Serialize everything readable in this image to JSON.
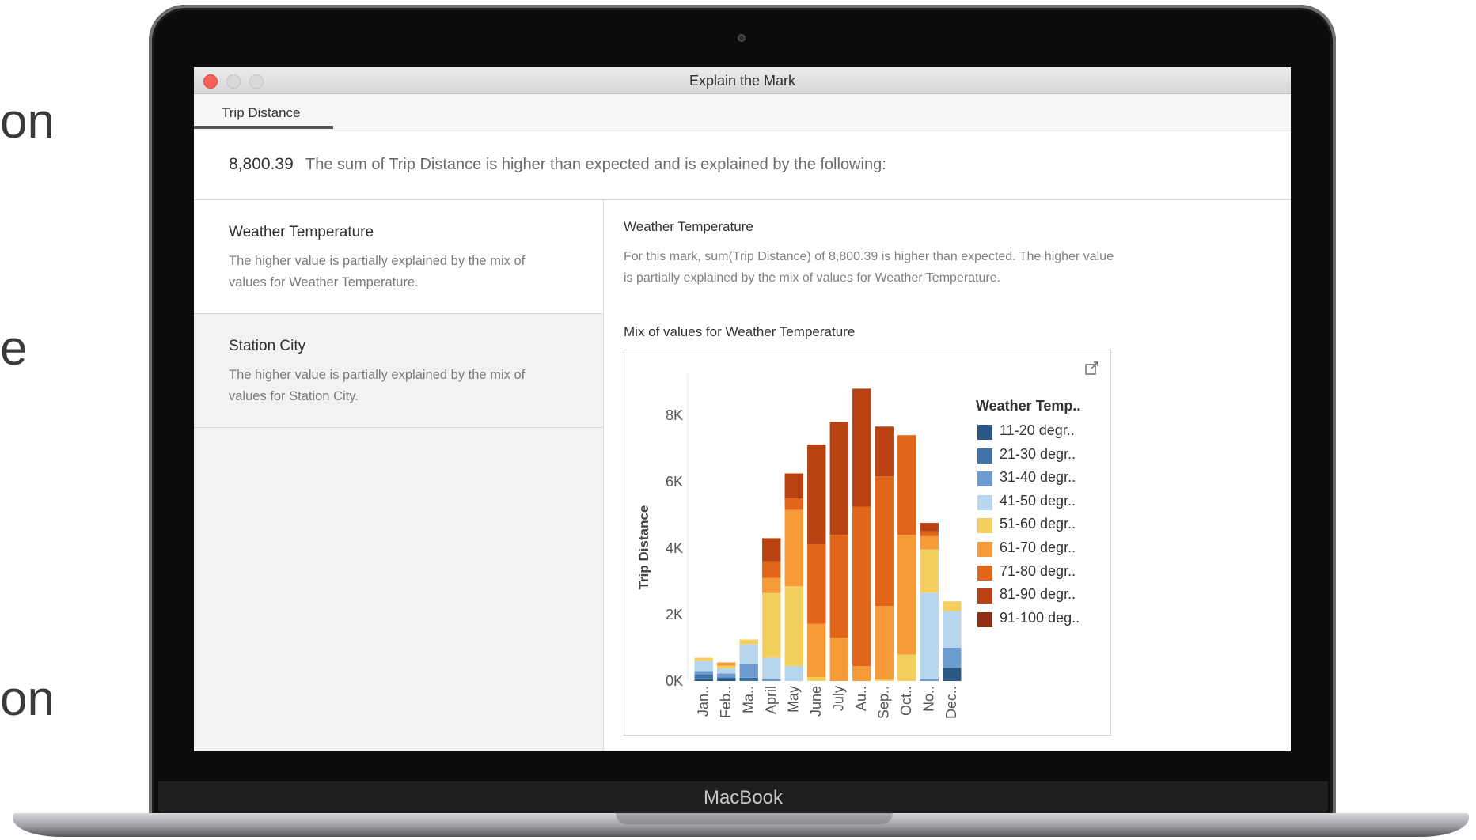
{
  "background_words": [
    "on",
    "e",
    "on"
  ],
  "device": {
    "brand": "MacBook"
  },
  "window": {
    "title": "Explain the Mark"
  },
  "tab": {
    "label": "Trip Distance"
  },
  "summary": {
    "value": "8,800.39",
    "text": "The sum of Trip Distance is higher than expected and is explained by the following:"
  },
  "explanations": [
    {
      "title": "Weather Temperature",
      "description": "The higher value is partially explained by the mix of values for Weather Temperature."
    },
    {
      "title": "Station City",
      "description": "The higher value is partially explained by the mix of values for Station City."
    }
  ],
  "detail": {
    "title": "Weather Temperature",
    "description": "For this mark, sum(Trip Distance) of 8,800.39 is higher than expected. The higher value is partially explained by the mix of values for Weather Temperature.",
    "chart_heading": "Mix of values for Weather Temperature"
  },
  "chart_data": {
    "type": "bar",
    "stacked": true,
    "ylabel": "Trip Distance",
    "yticks": [
      "0K",
      "2K",
      "4K",
      "6K",
      "8K"
    ],
    "ylim": [
      0,
      9000
    ],
    "categories": [
      "Jan..",
      "Feb..",
      "Ma..",
      "April",
      "May",
      "June",
      "July",
      "Au..",
      "Sep..",
      "Oct..",
      "No..",
      "Dec.."
    ],
    "legend_title": "Weather Temp..",
    "series": [
      {
        "name": "11-20 degr..",
        "color": "#2a5783",
        "values": [
          80,
          50,
          0,
          0,
          0,
          0,
          0,
          0,
          0,
          0,
          0,
          400
        ]
      },
      {
        "name": "21-30 degr..",
        "color": "#3e73a8",
        "values": [
          120,
          60,
          100,
          0,
          0,
          0,
          0,
          0,
          0,
          0,
          0,
          0
        ]
      },
      {
        "name": "31-40 degr..",
        "color": "#6c9bd0",
        "values": [
          100,
          120,
          400,
          50,
          0,
          0,
          0,
          0,
          0,
          0,
          60,
          600
        ]
      },
      {
        "name": "41-50 degr..",
        "color": "#b5d6ee",
        "values": [
          300,
          150,
          600,
          650,
          450,
          0,
          0,
          0,
          0,
          0,
          2600,
          1100
        ]
      },
      {
        "name": "51-60 degr..",
        "color": "#f5cf5e",
        "values": [
          100,
          80,
          150,
          1950,
          2400,
          120,
          0,
          0,
          60,
          800,
          1300,
          300
        ]
      },
      {
        "name": "61-70 degr..",
        "color": "#f49a37",
        "values": [
          0,
          100,
          0,
          450,
          2300,
          1600,
          1300,
          450,
          2200,
          3600,
          400,
          0
        ]
      },
      {
        "name": "71-80 degr..",
        "color": "#e1661a",
        "values": [
          0,
          0,
          0,
          500,
          350,
          2400,
          3100,
          4800,
          3900,
          3000,
          150,
          0
        ]
      },
      {
        "name": "81-90 degr..",
        "color": "#b84212",
        "values": [
          0,
          0,
          0,
          700,
          750,
          3000,
          3400,
          3550,
          1500,
          0,
          250,
          0
        ]
      },
      {
        "name": "91-100 deg..",
        "color": "#8e2f14",
        "values": [
          0,
          0,
          0,
          0,
          0,
          0,
          0,
          0,
          0,
          0,
          0,
          0
        ]
      }
    ]
  }
}
